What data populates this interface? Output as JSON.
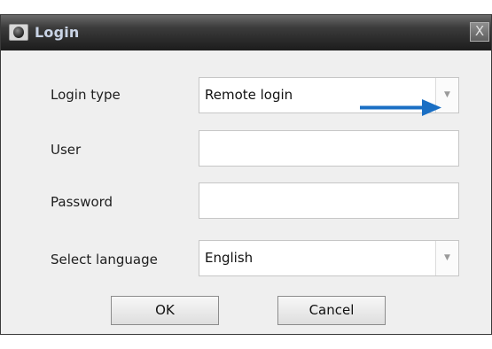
{
  "window": {
    "title": "Login",
    "close_label": "X"
  },
  "form": {
    "login_type": {
      "label": "Login type",
      "value": "Remote login"
    },
    "user": {
      "label": "User",
      "value": ""
    },
    "password": {
      "label": "Password",
      "value": ""
    },
    "language": {
      "label": "Select language",
      "value": "English"
    }
  },
  "buttons": {
    "ok": "OK",
    "cancel": "Cancel"
  },
  "annotation": {
    "arrow_color": "#1a6fc4"
  }
}
